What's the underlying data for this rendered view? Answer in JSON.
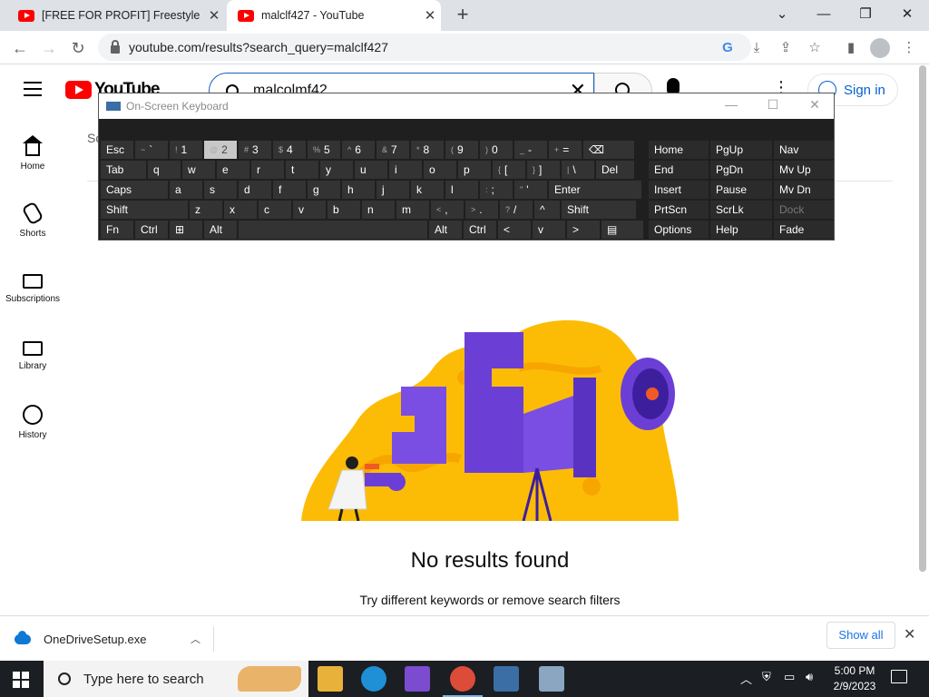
{
  "browser": {
    "tabs": [
      {
        "title": "[FREE FOR PROFIT] Freestyle Beat",
        "close": "✕"
      },
      {
        "title": "malclf427 - YouTube",
        "close": "✕"
      }
    ],
    "new_tab": "+",
    "window_controls": {
      "tab_search": "⌄",
      "minimize": "—",
      "restore": "❐",
      "close": "✕"
    },
    "url": "youtube.com/results?search_query=malclf427"
  },
  "youtube": {
    "logo_text": "YouTube",
    "search_query": "malcolmf42",
    "clear_icon": "✕",
    "more_icon": "⋮",
    "signin_label": "Sign in",
    "guide": [
      {
        "label": "Home"
      },
      {
        "label": "Shorts"
      },
      {
        "label": "Subscriptions"
      },
      {
        "label": "Library"
      },
      {
        "label": "History"
      }
    ],
    "filter_fragment": "Sc",
    "no_results_title": "No results found",
    "no_results_hint": "Try different keywords or remove search filters"
  },
  "osk": {
    "title": "On-Screen Keyboard",
    "controls": {
      "minimize": "—",
      "maximize": "☐",
      "close": "✕"
    },
    "rows": [
      [
        {
          "label": "Esc"
        },
        {
          "shift": "~",
          "label": "`"
        },
        {
          "shift": "!",
          "label": "1"
        },
        {
          "shift": "@",
          "label": "2",
          "hl": true
        },
        {
          "shift": "#",
          "label": "3"
        },
        {
          "shift": "$",
          "label": "4"
        },
        {
          "shift": "%",
          "label": "5"
        },
        {
          "shift": "^",
          "label": "6"
        },
        {
          "shift": "&",
          "label": "7"
        },
        {
          "shift": "*",
          "label": "8"
        },
        {
          "shift": "(",
          "label": "9"
        },
        {
          "shift": ")",
          "label": "0"
        },
        {
          "shift": "_",
          "label": "-"
        },
        {
          "shift": "+",
          "label": "="
        },
        {
          "label": "⌫"
        }
      ],
      [
        {
          "label": "Tab"
        },
        {
          "label": "q"
        },
        {
          "label": "w"
        },
        {
          "label": "e"
        },
        {
          "label": "r"
        },
        {
          "label": "t"
        },
        {
          "label": "y"
        },
        {
          "label": "u"
        },
        {
          "label": "i"
        },
        {
          "label": "o"
        },
        {
          "label": "p"
        },
        {
          "shift": "{",
          "label": "["
        },
        {
          "shift": "}",
          "label": "]"
        },
        {
          "shift": "|",
          "label": "\\"
        },
        {
          "label": "Del"
        }
      ],
      [
        {
          "label": "Caps"
        },
        {
          "label": "a"
        },
        {
          "label": "s"
        },
        {
          "label": "d"
        },
        {
          "label": "f"
        },
        {
          "label": "g"
        },
        {
          "label": "h"
        },
        {
          "label": "j"
        },
        {
          "label": "k"
        },
        {
          "label": "l"
        },
        {
          "shift": ":",
          "label": ";"
        },
        {
          "shift": "\"",
          "label": "'"
        },
        {
          "label": "Enter"
        }
      ],
      [
        {
          "label": "Shift"
        },
        {
          "label": "z"
        },
        {
          "label": "x"
        },
        {
          "label": "c"
        },
        {
          "label": "v"
        },
        {
          "label": "b"
        },
        {
          "label": "n"
        },
        {
          "label": "m"
        },
        {
          "shift": "<",
          "label": ","
        },
        {
          "shift": ">",
          "label": "."
        },
        {
          "shift": "?",
          "label": "/"
        },
        {
          "label": "^"
        },
        {
          "label": "Shift"
        }
      ],
      [
        {
          "label": "Fn"
        },
        {
          "label": "Ctrl"
        },
        {
          "label": "⊞"
        },
        {
          "label": "Alt"
        },
        {
          "label": ""
        },
        {
          "label": "Alt"
        },
        {
          "label": "Ctrl"
        },
        {
          "label": "<"
        },
        {
          "label": "v"
        },
        {
          "label": ">"
        },
        {
          "label": "▤"
        }
      ]
    ],
    "nav_keys": [
      [
        "Home",
        "PgUp",
        "Nav"
      ],
      [
        "End",
        "PgDn",
        "Mv Up"
      ],
      [
        "Insert",
        "Pause",
        "Mv Dn"
      ],
      [
        "PrtScn",
        "ScrLk",
        "Dock"
      ],
      [
        "Options",
        "Help",
        "Fade"
      ]
    ]
  },
  "download": {
    "filename": "OneDriveSetup.exe",
    "show_all": "Show all",
    "close": "✕"
  },
  "taskbar": {
    "search_placeholder": "Type here to search",
    "time": "5:00 PM",
    "date": "2/9/2023"
  },
  "colors": {
    "youtube_red": "#ff0000",
    "signin_blue": "#065fd4",
    "illustration_yellow": "#fcbc05",
    "illustration_purple": "#6b3fd6"
  }
}
